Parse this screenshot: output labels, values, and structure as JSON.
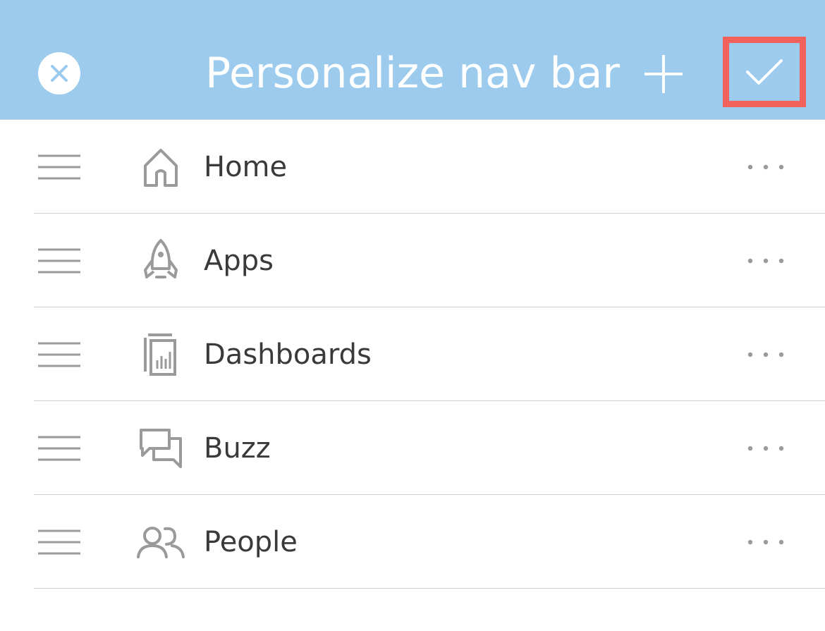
{
  "header": {
    "title": "Personalize nav bar",
    "close_icon": "close-icon",
    "add_icon": "plus-icon",
    "done_icon": "checkmark-icon"
  },
  "items": [
    {
      "label": "Home",
      "icon": "home-icon"
    },
    {
      "label": "Apps",
      "icon": "rocket-icon"
    },
    {
      "label": "Dashboards",
      "icon": "dashboard-icon"
    },
    {
      "label": "Buzz",
      "icon": "chat-bubbles-icon"
    },
    {
      "label": "People",
      "icon": "people-icon"
    }
  ],
  "colors": {
    "header_bg": "#9ccbee",
    "highlight_border": "#f2625a",
    "icon_gray": "#9a9a9a",
    "text": "#3a3a3a"
  }
}
